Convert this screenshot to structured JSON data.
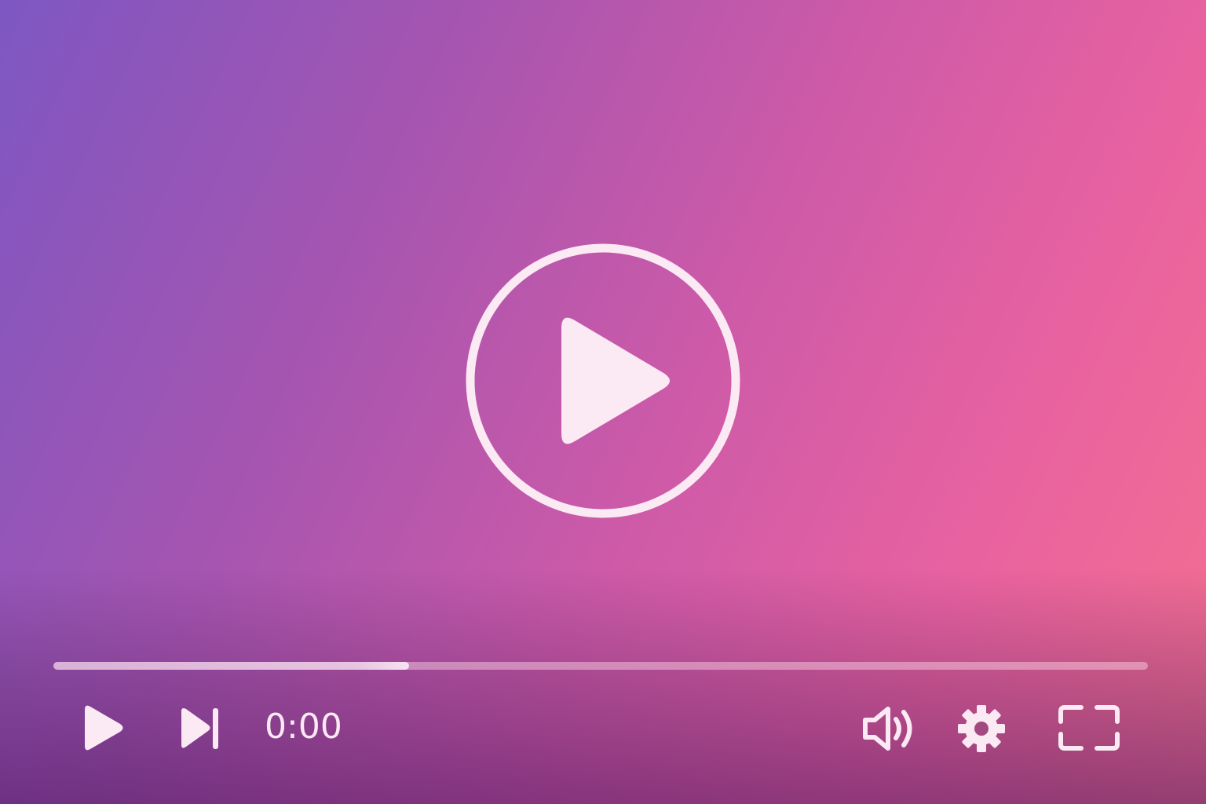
{
  "player": {
    "state": "paused",
    "current_time": "0:00",
    "played_fraction": 0.0,
    "buffered_fraction": 0.325,
    "icons": {
      "center": "play-circle-icon",
      "play": "play-icon",
      "next": "skip-next-icon",
      "volume": "volume-icon",
      "settings": "gear-icon",
      "fullscreen": "fullscreen-icon"
    },
    "colors": {
      "icon": "#fbe9f3",
      "gradient_start": "#7e57c2",
      "gradient_end": "#f4708f"
    }
  }
}
